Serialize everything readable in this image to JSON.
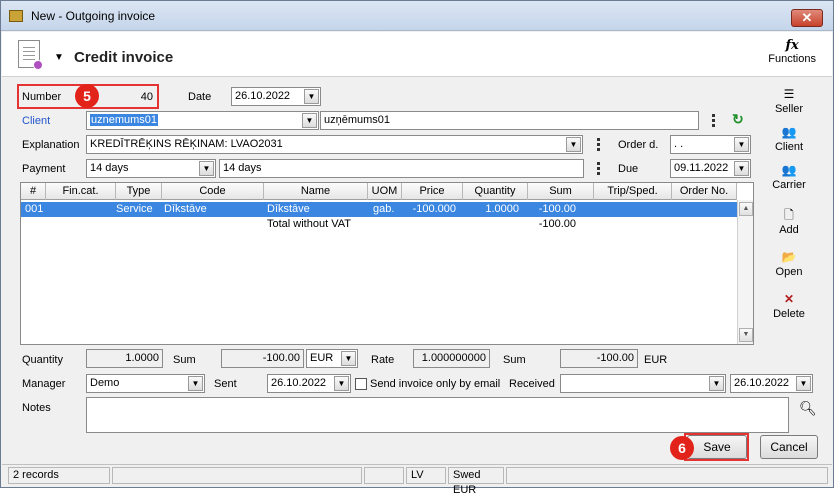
{
  "window": {
    "title": "New - Outgoing invoice",
    "close_icon": "close-icon"
  },
  "header": {
    "title": "Credit invoice",
    "functions_label": "Functions",
    "functions_symbol": "fx"
  },
  "form": {
    "number_label": "Number",
    "number_value": "40",
    "date_label": "Date",
    "date_value": "26.10.2022",
    "client_label": "Client",
    "client_code": "uznemums01",
    "client_name": "uzņēmums01",
    "explanation_label": "Explanation",
    "explanation_value": "KREDĪTRĒĶINS RĒĶINAM: LVAO2031",
    "order_d_label": "Order d.",
    "order_d_value": ". .",
    "payment_label": "Payment",
    "payment_value": "14 days",
    "payment_text": "14 days",
    "due_label": "Due",
    "due_value": "09.11.2022"
  },
  "grid": {
    "columns": [
      "#",
      "Fin.cat.",
      "Type",
      "Code",
      "Name",
      "UOM",
      "Price",
      "Quantity",
      "Sum",
      "Trip/Sped.",
      "Order No."
    ],
    "row1": {
      "num": "001",
      "fincat": "",
      "type": "Service",
      "code": "Dīkstāve",
      "name": "Dīkstāve",
      "uom": "gab.",
      "price": "-100.000",
      "quantity": "1.0000",
      "sum": "-100.00"
    },
    "row2": {
      "name": "Total without VAT",
      "sum": "-100.00"
    }
  },
  "totals": {
    "quantity_label": "Quantity",
    "quantity_value": "1.0000",
    "sum_label": "Sum",
    "sum_value": "-100.00",
    "currency": "EUR",
    "rate_label": "Rate",
    "rate_value": "1.000000000",
    "sum2_label": "Sum",
    "sum2_value": "-100.00",
    "currency2": "EUR"
  },
  "bottom": {
    "manager_label": "Manager",
    "manager_value": "Demo",
    "sent_label": "Sent",
    "sent_value": "26.10.2022",
    "send_email_label": "Send invoice only by email",
    "received_label": "Received",
    "received_value": "",
    "received_date": "26.10.2022",
    "notes_label": "Notes",
    "notes_value": ""
  },
  "side_tools": {
    "seller": "Seller",
    "client": "Client",
    "carrier": "Carrier",
    "add": "Add",
    "open": "Open",
    "delete": "Delete"
  },
  "buttons": {
    "save": "Save",
    "cancel": "Cancel"
  },
  "callouts": {
    "first": "5",
    "second": "6"
  },
  "status": {
    "records": "2 records",
    "lang": "LV",
    "company": "Swed EUR"
  },
  "colors": {
    "highlight": "#e53333",
    "selection": "#3a86e0",
    "link": "#2255cc"
  }
}
